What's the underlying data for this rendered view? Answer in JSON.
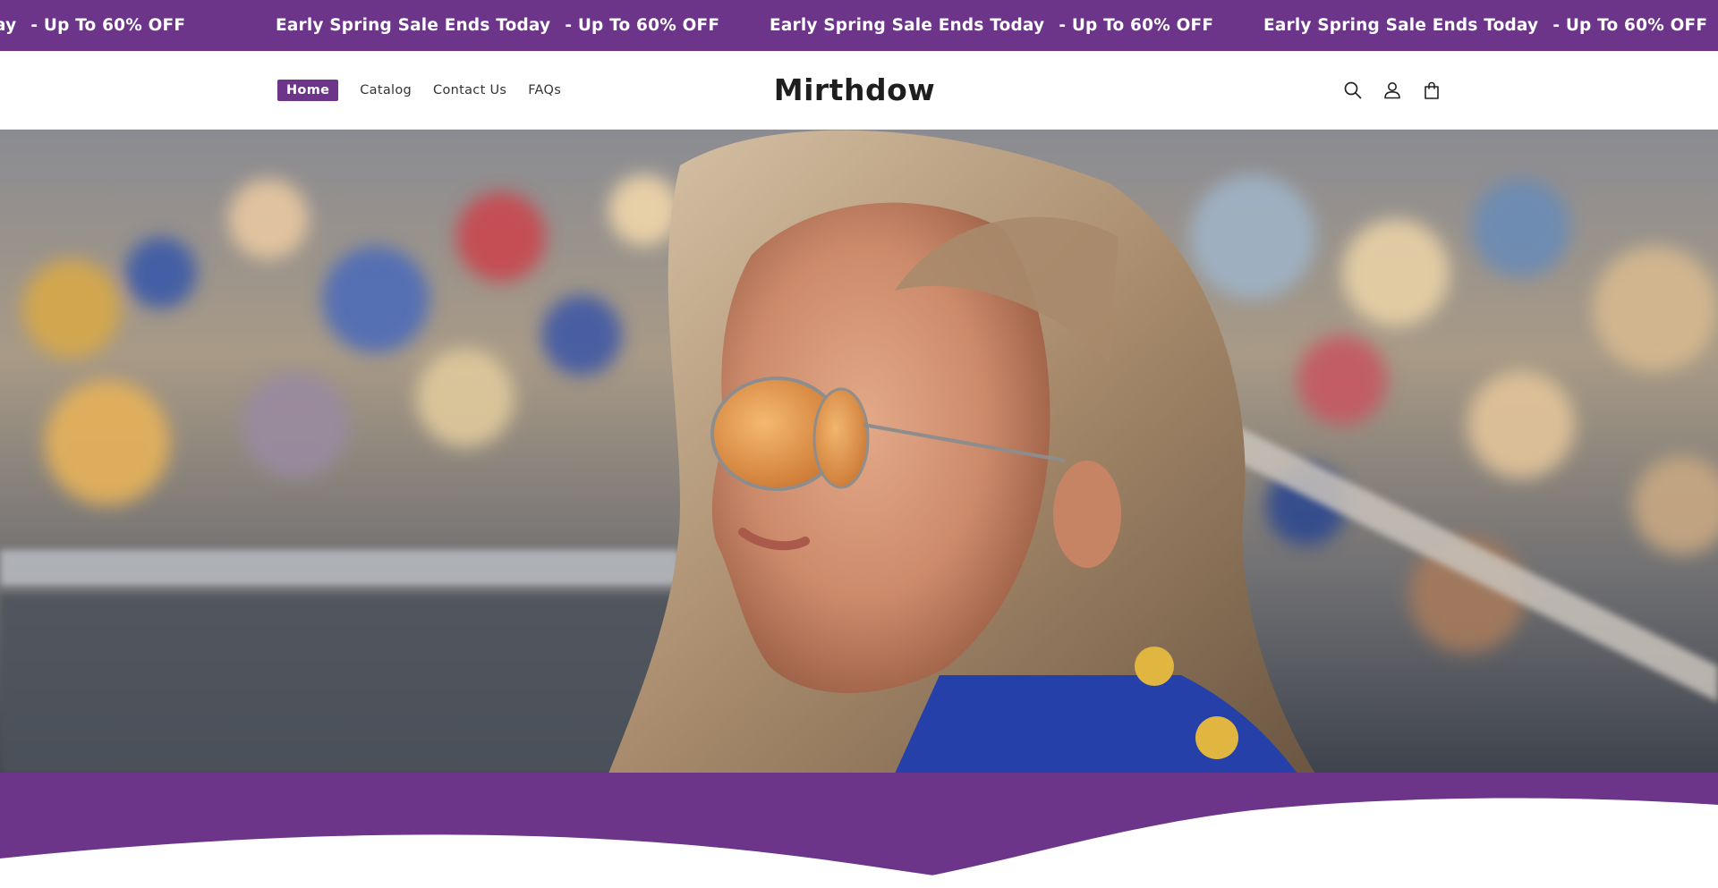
{
  "announcement": {
    "part1": "Early Spring Sale Ends Today",
    "part2": "- Up To 60% OFF",
    "tail_visible": "ay"
  },
  "header": {
    "nav": [
      {
        "label": "Home",
        "active": true
      },
      {
        "label": "Catalog",
        "active": false
      },
      {
        "label": "Contact Us",
        "active": false
      },
      {
        "label": "FAQs",
        "active": false
      }
    ],
    "logo": "Mirthdow",
    "icons": [
      "search-icon",
      "account-icon",
      "cart-icon"
    ]
  },
  "hero": {
    "image": "woman-with-orange-aviator-sunglasses-at-fairground"
  },
  "colors": {
    "brand": "#6c358a",
    "white": "#ffffff",
    "text": "#1e1e1e"
  }
}
